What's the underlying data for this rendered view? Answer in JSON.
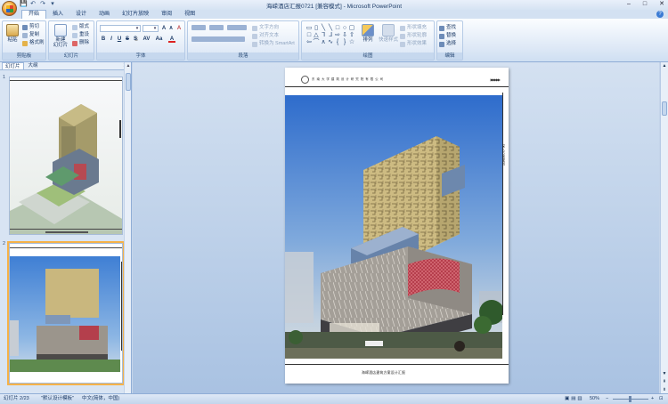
{
  "window": {
    "title": "海嵘酒店汇报0721 [兼容模式] - Microsoft PowerPoint",
    "controls": [
      "–",
      "□",
      "✕"
    ]
  },
  "quick_access": [
    "💾",
    "↶",
    "↷",
    "▾"
  ],
  "tabs": [
    "开始",
    "插入",
    "设计",
    "动画",
    "幻灯片放映",
    "审阅",
    "视图"
  ],
  "ribbon": {
    "clipboard": {
      "label": "剪贴板",
      "paste": "粘贴",
      "cut": "剪切",
      "copy": "复制",
      "format_painter": "格式刷"
    },
    "slides": {
      "label": "幻灯片",
      "new_slide": "新建\n幻灯片",
      "layout": "版式",
      "reset": "重设",
      "delete": "删除"
    },
    "font": {
      "label": "字体",
      "font_name": "",
      "font_size": "",
      "grow": "A",
      "shrink": "A",
      "clear": "A",
      "bold": "B",
      "italic": "I",
      "underline": "U",
      "strike": "S",
      "shadow": "S",
      "spacing": "AV",
      "case": "Aa",
      "color": "A"
    },
    "paragraph": {
      "label": "段落",
      "text_direction": "文字方向",
      "align_text": "对齐文本",
      "smartart": "转换为 SmartArt"
    },
    "drawing": {
      "label": "绘图",
      "arrange": "排列",
      "quick_styles": "快速样式",
      "shape_fill": "形状填充",
      "shape_outline": "形状轮廓",
      "shape_effects": "形状效果"
    },
    "editing": {
      "label": "编辑",
      "find": "查找",
      "replace": "替换",
      "select": "选择"
    }
  },
  "pane": {
    "tabs": [
      "幻灯片",
      "大纲"
    ],
    "close": "✕",
    "thumbs": [
      {
        "number": "1"
      },
      {
        "number": "2"
      }
    ]
  },
  "slide": {
    "header_text": "东 南 大 学 建 筑 设 计 研 究 院 有 限 公 司",
    "header_arrows": "▶▶▶▶▶",
    "side_text": "深入方案规划",
    "footer_text": "海嵘酒店建筑方案设计汇报"
  },
  "status": {
    "slide_info": "幻灯片 2/23",
    "theme": "\"默认设计模板\"",
    "language": "中文(简体，中国)",
    "zoom": "50%",
    "zoom_minus": "−",
    "zoom_plus": "+"
  },
  "colors": {
    "accent": "#f6b248",
    "ribbon_bg": "#dde8f6",
    "workspace": "#a9c2e2",
    "selection": "#f6b248"
  }
}
